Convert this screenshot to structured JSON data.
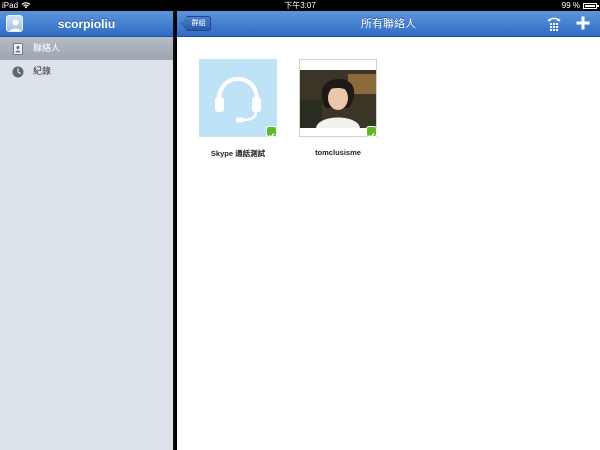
{
  "statusbar": {
    "device": "iPad",
    "time": "下午3:07",
    "battery": "99 %",
    "battery_level": 0.99
  },
  "sidebar": {
    "username": "scorpioliu",
    "items": [
      {
        "label": "聯絡人",
        "icon": "contacts-icon",
        "selected": true
      },
      {
        "label": "紀錄",
        "icon": "clock-icon",
        "selected": false
      }
    ]
  },
  "navbar": {
    "back_label": "群組",
    "title": "所有聯絡人",
    "right_icons": [
      "dialpad-icon",
      "plus-icon"
    ]
  },
  "contacts": [
    {
      "name": "Skype 通話測試",
      "avatar": "headset-icon",
      "status": "online"
    },
    {
      "name": "tomclusisme",
      "avatar": "photo",
      "status": "online"
    }
  ],
  "colors": {
    "header_blue": "#3a78cf",
    "sidebar_bg": "#dde3ea",
    "online_green": "#5db82a",
    "skype_tile": "#bfe3f6"
  }
}
